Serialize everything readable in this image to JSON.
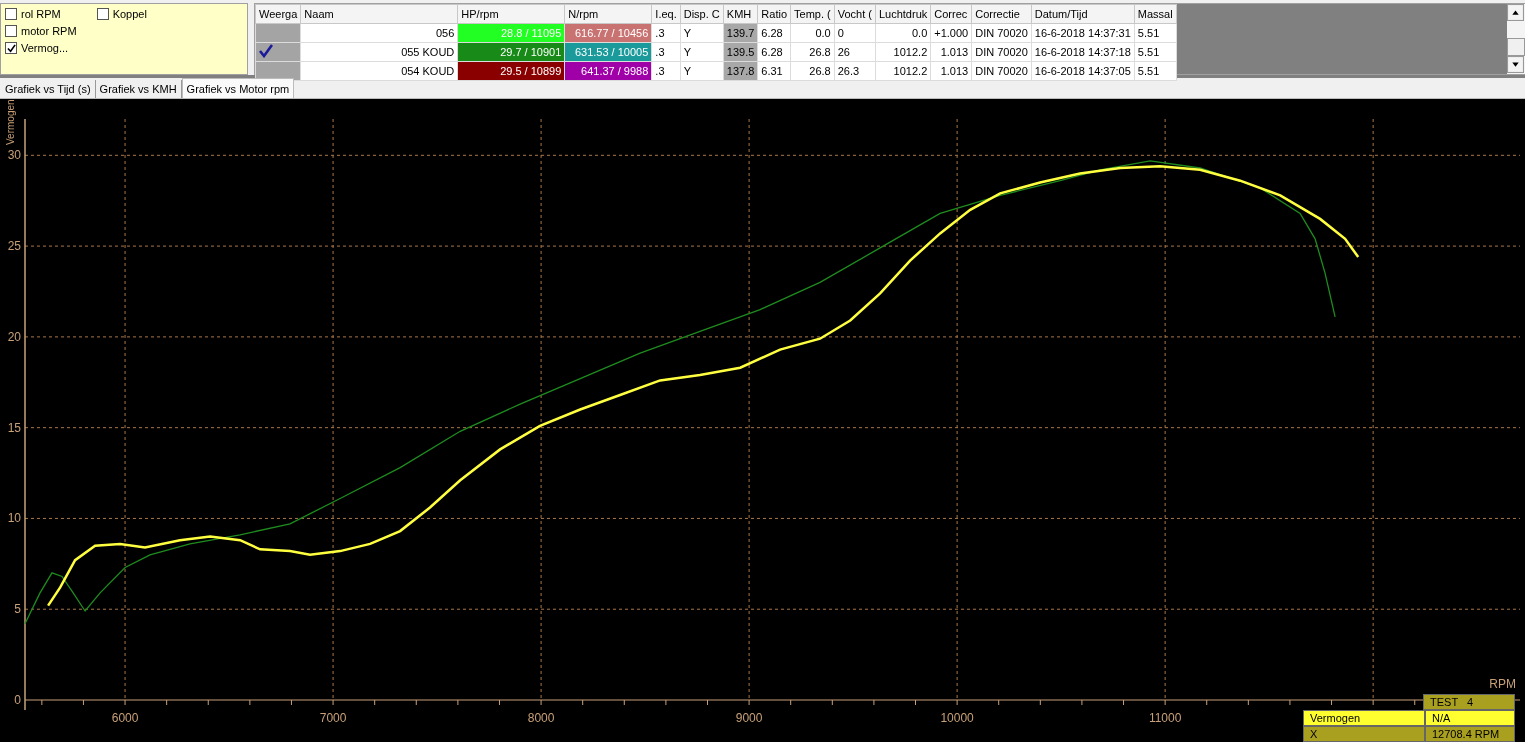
{
  "option_columns": [
    [
      {
        "label": "rol RPM",
        "checked": false
      },
      {
        "label": "motor RPM",
        "checked": false
      },
      {
        "label": "Vermog...",
        "checked": true
      }
    ],
    [
      {
        "label": "Koppel",
        "checked": false
      }
    ]
  ],
  "table": {
    "columns": [
      "Weerga",
      "Naam",
      "HP/rpm",
      "N/rpm",
      "I.eq.",
      "Disp. C",
      "KMH",
      "Ratio",
      "Temp. (",
      "Vocht (",
      "Luchtdruk",
      "Correc",
      "Correctie",
      "Datum/Tijd",
      "Massal"
    ],
    "rows": [
      {
        "shown": false,
        "naam": "056",
        "hp": {
          "text": "28.8 / 11095",
          "color": "#22ff22"
        },
        "n": {
          "text": "616.77 / 10456",
          "color": "#c87272"
        },
        "ieq": ".3",
        "disp": "Y",
        "kmh": "139.7",
        "ratio": "6.28",
        "temp": "0.0",
        "vocht": "0",
        "luchtdruk": "0.0",
        "correc": "+1.000",
        "correctie": "DIN 70020",
        "datum": "16-6-2018 14:37:31",
        "massa": "5.51"
      },
      {
        "shown": true,
        "naam": "055 KOUD",
        "hp": {
          "text": "29.7 / 10901",
          "color": "#178a17"
        },
        "n": {
          "text": "631.53 / 10005",
          "color": "#1a9a9a"
        },
        "ieq": ".3",
        "disp": "Y",
        "kmh": "139.5",
        "ratio": "6.28",
        "temp": "26.8",
        "vocht": "26",
        "luchtdruk": "1012.2",
        "correc": "1.013",
        "correctie": "DIN 70020",
        "datum": "16-6-2018 14:37:18",
        "massa": "5.51"
      },
      {
        "shown": false,
        "naam": "054 KOUD",
        "hp": {
          "text": "29.5 / 10899",
          "color": "#8a0000"
        },
        "n": {
          "text": "641.37 / 9988",
          "color": "#a000a8"
        },
        "ieq": ".3",
        "disp": "Y",
        "kmh": "137.8",
        "ratio": "6.31",
        "temp": "26.8",
        "vocht": "26.3",
        "luchtdruk": "1012.2",
        "correc": "1.013",
        "correctie": "DIN 70020",
        "datum": "16-6-2018 14:37:05",
        "massa": "5.51"
      }
    ]
  },
  "tabs": [
    {
      "label": "Grafiek vs Tijd (s)",
      "selected": false
    },
    {
      "label": "Grafiek vs KMH",
      "selected": false
    },
    {
      "label": "Grafiek vs Motor rpm",
      "selected": true
    }
  ],
  "chart": {
    "chart_data": {
      "type": "line",
      "grid": true,
      "xlabel": "RPM",
      "ylabel": "Vermogen",
      "xlim": [
        5519,
        12706
      ],
      "ylim": [
        0,
        32
      ],
      "xticks": [
        6000,
        7000,
        8000,
        9000,
        10000,
        11000
      ],
      "yticks": [
        0,
        5,
        10,
        15,
        20,
        25,
        30
      ],
      "series": [
        {
          "color": "#1e8c1e",
          "x": [
            5519,
            5591,
            5649,
            5697,
            5745,
            5808,
            5880,
            6000,
            6120,
            6312,
            6553,
            6793,
            7034,
            7322,
            7611,
            7899,
            8188,
            8476,
            8764,
            9053,
            9341,
            9630,
            9918,
            10207,
            10495,
            10688,
            10928,
            11168,
            11457,
            11649,
            11721,
            11769,
            11817
          ],
          "values": [
            4.2,
            5.9,
            7.0,
            6.8,
            6.0,
            4.9,
            5.9,
            7.3,
            8.0,
            8.6,
            9.1,
            9.7,
            11.1,
            12.8,
            14.8,
            16.3,
            17.7,
            19.1,
            20.3,
            21.5,
            23.0,
            24.9,
            26.8,
            27.8,
            28.6,
            29.2,
            29.7,
            29.3,
            28.2,
            26.8,
            25.4,
            23.5,
            21.1
          ]
        },
        {
          "color": "#ffff40",
          "x": [
            5630,
            5688,
            5760,
            5856,
            5976,
            6096,
            6264,
            6409,
            6553,
            6649,
            6793,
            6889,
            7034,
            7178,
            7322,
            7466,
            7611,
            7803,
            7995,
            8188,
            8380,
            8572,
            8764,
            8957,
            9149,
            9341,
            9486,
            9630,
            9774,
            9918,
            10063,
            10207,
            10399,
            10591,
            10784,
            10976,
            11168,
            11361,
            11553,
            11745,
            11865,
            11928
          ],
          "values": [
            5.2,
            6.2,
            7.7,
            8.5,
            8.6,
            8.4,
            8.8,
            9.0,
            8.8,
            8.3,
            8.2,
            8.0,
            8.2,
            8.6,
            9.3,
            10.6,
            12.1,
            13.8,
            15.1,
            16.0,
            16.8,
            17.6,
            17.9,
            18.3,
            19.3,
            19.9,
            20.9,
            22.4,
            24.2,
            25.7,
            27.0,
            27.9,
            28.5,
            29.0,
            29.3,
            29.4,
            29.2,
            28.6,
            27.8,
            26.5,
            25.4,
            24.4
          ]
        }
      ]
    },
    "legend": {
      "title": "TEST   4",
      "rows": [
        {
          "label": "Vermogen",
          "value": "N/A",
          "highlighted": true
        },
        {
          "label": "X",
          "value": "12708.4 RPM",
          "highlighted": false
        }
      ]
    }
  }
}
